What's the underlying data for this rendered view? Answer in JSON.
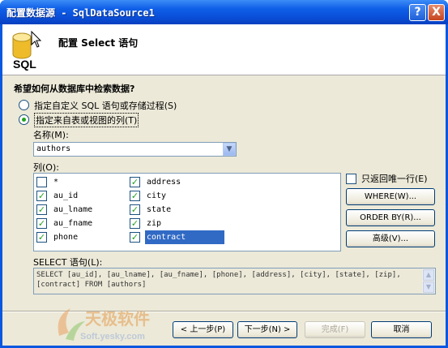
{
  "window": {
    "title": "配置数据源 - SqlDataSource1",
    "help_label": "?",
    "close_label": "X"
  },
  "header": {
    "title": "配置 Select 语句",
    "icon_label": "SQL"
  },
  "question": "希望如何从数据库中检索数据?",
  "options": {
    "custom_sql": "指定自定义 SQL 语句或存储过程(S)",
    "from_table": "指定来自表或视图的列(T)"
  },
  "name_label": "名称(M):",
  "table_combo": {
    "value": "authors"
  },
  "columns_label": "列(O):",
  "columns": [
    {
      "name": "*",
      "checked": false
    },
    {
      "name": "au_id",
      "checked": true
    },
    {
      "name": "au_lname",
      "checked": true
    },
    {
      "name": "au_fname",
      "checked": true
    },
    {
      "name": "phone",
      "checked": true
    },
    {
      "name": "address",
      "checked": true
    },
    {
      "name": "city",
      "checked": true
    },
    {
      "name": "state",
      "checked": true
    },
    {
      "name": "zip",
      "checked": true
    },
    {
      "name": "contract",
      "checked": true
    }
  ],
  "unique_rows_label": "只返回唯一行(E)",
  "buttons": {
    "where": "WHERE(W)...",
    "order_by": "ORDER BY(R)...",
    "advanced": "高级(V)...",
    "back": "< 上一步(P)",
    "next": "下一步(N) >",
    "finish": "完成(F)",
    "cancel": "取消"
  },
  "select_label": "SELECT 语句(L):",
  "select_statement": "SELECT [au_id], [au_lname], [au_fname], [phone], [address], [city], [state], [zip], [contract] FROM [authors]",
  "watermark": {
    "text": "天极软件",
    "url": "Soft.yesky.com"
  },
  "colors": {
    "titlebar": "#0a58e0",
    "dialog_bg": "#ece9d8",
    "selection": "#316ac5",
    "check": "#21a121"
  }
}
